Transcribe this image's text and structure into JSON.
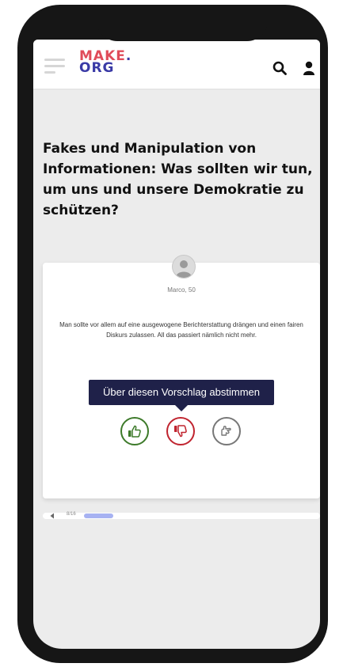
{
  "app": {
    "logo_line1": "MAKE",
    "logo_dot": ".",
    "logo_line2": "ORG"
  },
  "consultation": {
    "question": "Fakes und Manipulation von Informationen: Was sollten wir tun, um uns und unsere Demokratie zu schützen?"
  },
  "proposal_card": {
    "author": "Marco, 50",
    "text": "Man sollte vor allem auf eine ausgewogene Berichterstattung drängen und einen fairen Diskurs zulassen. All das passiert nämlich nicht mehr."
  },
  "vote": {
    "tooltip": "Über diesen Vorschlag abstimmen",
    "agree_color": "#3d7a2a",
    "disagree_color": "#c0242f",
    "neutral_color": "#777777"
  },
  "progress": {
    "label": "8/16",
    "fraction": 0.125
  },
  "icons": [
    "menu-icon",
    "search-icon",
    "user-icon",
    "thumbs-up-icon",
    "thumbs-down-icon",
    "neutral-hand-icon",
    "previous-icon"
  ],
  "colors": {
    "brand_red": "#e04c5a",
    "brand_blue": "#3a3aa6",
    "tooltip_bg": "#1f2149",
    "progress": "#a7b2f2"
  }
}
